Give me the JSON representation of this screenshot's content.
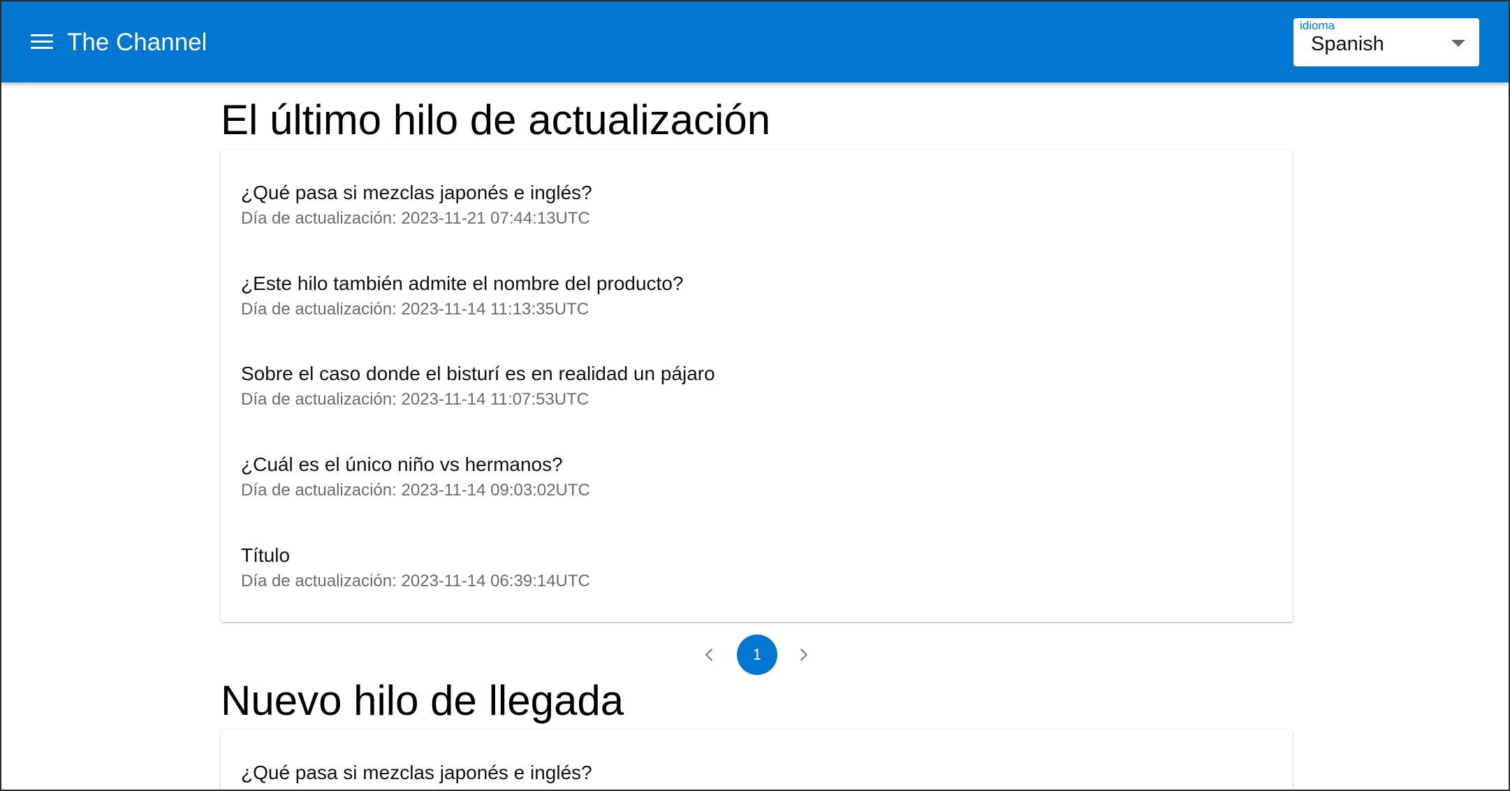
{
  "header": {
    "app_title": "The Channel",
    "language": {
      "label": "idioma",
      "value": "Spanish"
    }
  },
  "colors": {
    "primary": "#0277d1",
    "date_text": "#6b6b6b"
  },
  "icons": {
    "menu": "hamburger-menu-icon",
    "select": "arrow-drop-down-icon",
    "prev": "chevron-left-icon",
    "next": "chevron-right-icon"
  },
  "latest_section": {
    "title": "El último hilo de actualización",
    "threads": [
      {
        "title": "¿Qué pasa si mezclas japonés e inglés?",
        "date": "Día de actualización: 2023-11-21 07:44:13UTC"
      },
      {
        "title": "¿Este hilo también admite el nombre del producto?",
        "date": "Día de actualización: 2023-11-14 11:13:35UTC"
      },
      {
        "title": "Sobre el caso donde el bisturí es en realidad un pájaro",
        "date": "Día de actualización: 2023-11-14 11:07:53UTC"
      },
      {
        "title": "¿Cuál es el único niño vs hermanos?",
        "date": "Día de actualización: 2023-11-14 09:03:02UTC"
      },
      {
        "title": "Título",
        "date": "Día de actualización: 2023-11-14 06:39:14UTC"
      }
    ]
  },
  "pagination": {
    "current_page": "1"
  },
  "new_section": {
    "title": "Nuevo hilo de llegada",
    "threads": [
      {
        "title": "¿Qué pasa si mezclas japonés e inglés?"
      }
    ]
  }
}
